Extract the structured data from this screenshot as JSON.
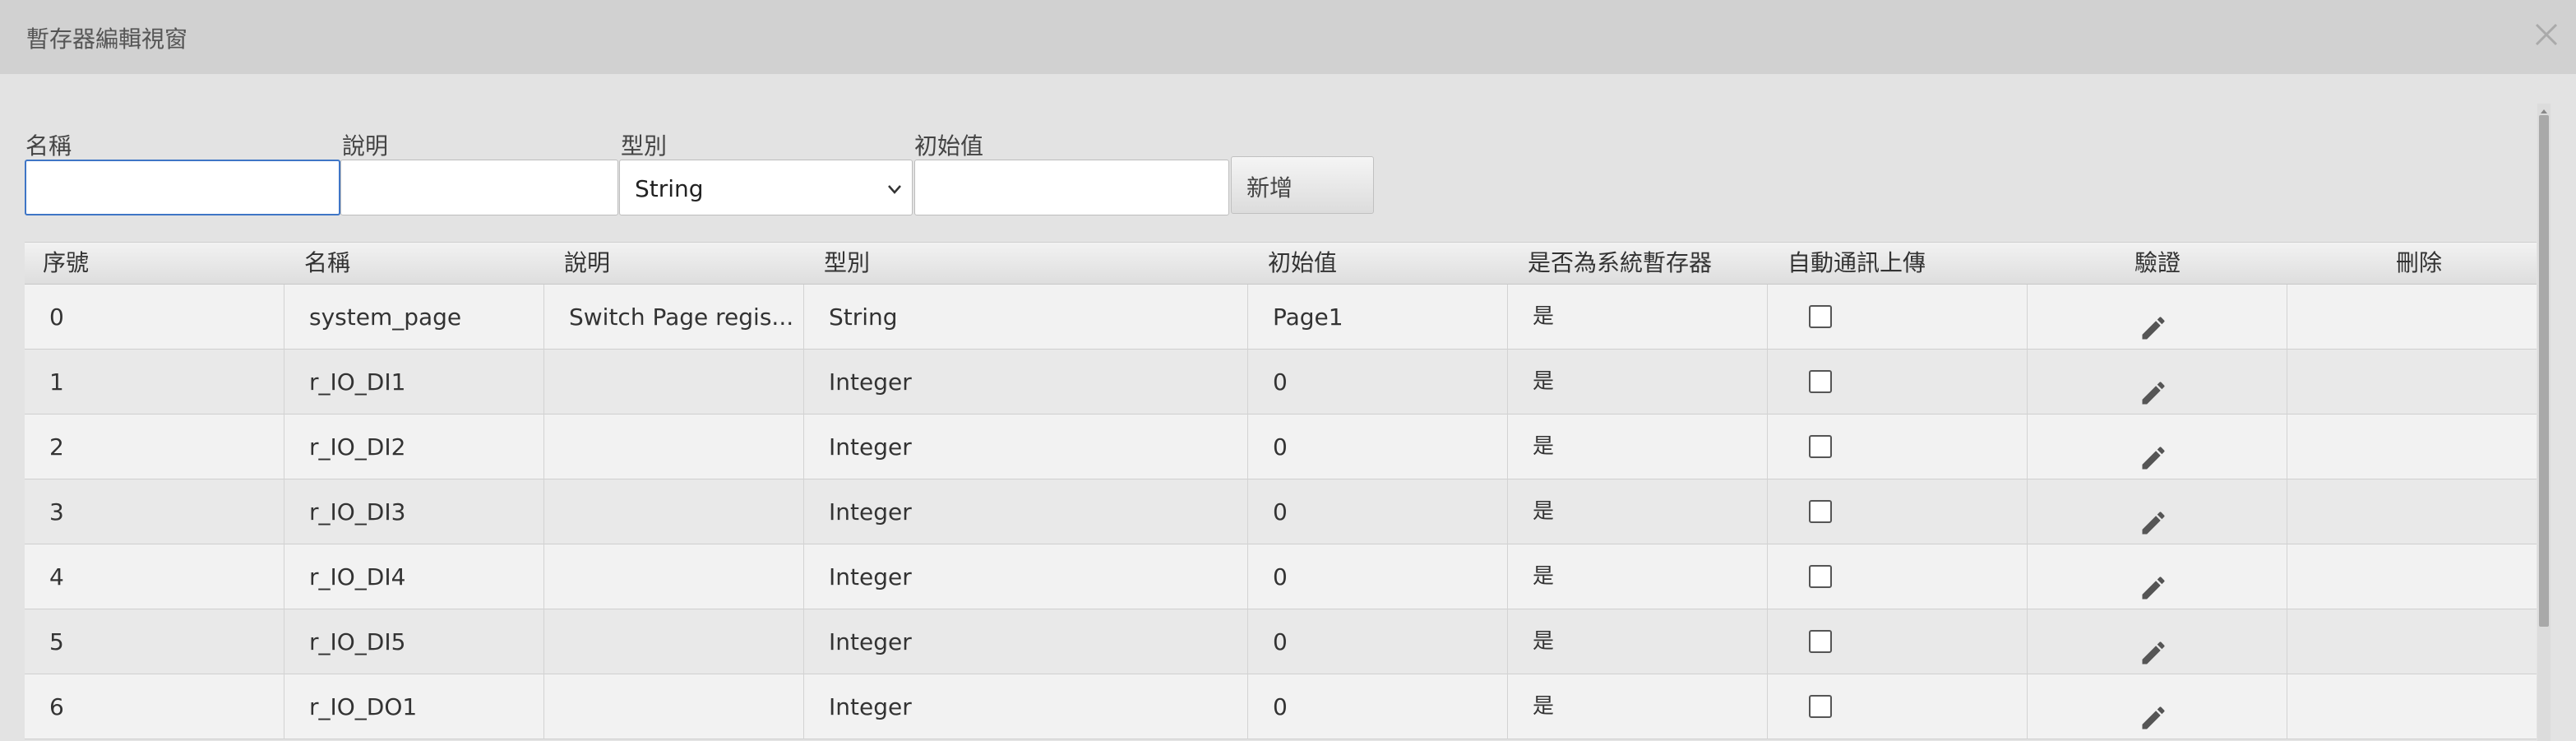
{
  "window": {
    "title": "暫存器編輯視窗"
  },
  "form": {
    "name_label": "名稱",
    "desc_label": "說明",
    "type_label": "型別",
    "init_label": "初始值",
    "name_value": "",
    "desc_value": "",
    "init_value": "",
    "type_selected": "String",
    "add_button": "新增"
  },
  "table": {
    "headers": [
      "序號",
      "名稱",
      "說明",
      "型別",
      "初始值",
      "是否為系統暫存器",
      "自動通訊上傳",
      "驗證",
      "刪除"
    ],
    "rows": [
      {
        "index": "0",
        "name": "system_page",
        "desc": "Switch Page regis...",
        "type": "String",
        "init": "Page1",
        "system": "是"
      },
      {
        "index": "1",
        "name": "r_IO_DI1",
        "desc": "",
        "type": "Integer",
        "init": "0",
        "system": "是"
      },
      {
        "index": "2",
        "name": "r_IO_DI2",
        "desc": "",
        "type": "Integer",
        "init": "0",
        "system": "是"
      },
      {
        "index": "3",
        "name": "r_IO_DI3",
        "desc": "",
        "type": "Integer",
        "init": "0",
        "system": "是"
      },
      {
        "index": "4",
        "name": "r_IO_DI4",
        "desc": "",
        "type": "Integer",
        "init": "0",
        "system": "是"
      },
      {
        "index": "5",
        "name": "r_IO_DI5",
        "desc": "",
        "type": "Integer",
        "init": "0",
        "system": "是"
      },
      {
        "index": "6",
        "name": "r_IO_DO1",
        "desc": "",
        "type": "Integer",
        "init": "0",
        "system": "是"
      }
    ]
  },
  "icons": {
    "close": "close-icon",
    "edit": "pencil-icon",
    "checkbox": "checkbox-icon",
    "dropdown": "chevron-down-icon"
  },
  "colors": {
    "titlebar": "#d1d1d1",
    "background": "#e3e3e3",
    "focus": "#3f76c6"
  }
}
